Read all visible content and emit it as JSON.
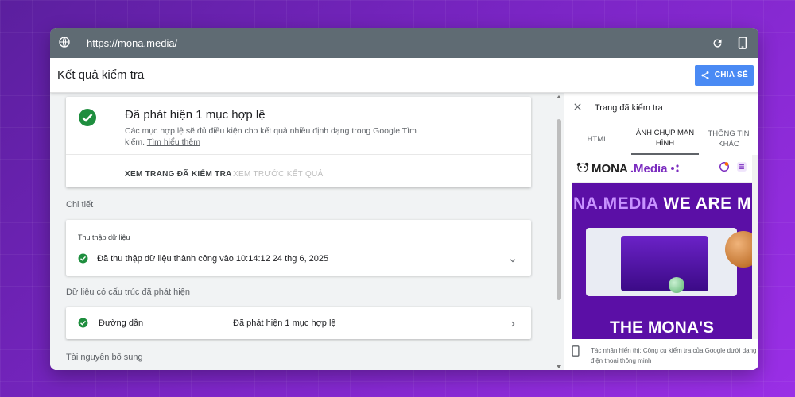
{
  "browser": {
    "url": "https://mona.media/"
  },
  "appbar": {
    "title": "Kết quả kiểm tra",
    "share_label": "CHIA SẺ"
  },
  "summary": {
    "heading": "Đã phát hiện 1 mục hợp lệ",
    "description": "Các mục hợp lệ sẽ đủ điều kiện cho kết quả nhiều định dạng trong Google Tìm kiếm.",
    "learn_more": "Tìm hiểu thêm",
    "view_tested_page": "XEM TRANG ĐÃ KIỂM TRA",
    "preview_results": "XEM TRƯỚC KẾT QUẢ"
  },
  "details": {
    "section_label": "Chi tiết",
    "crawl_label": "Thu thập dữ liệu",
    "crawl_status": "Đã thu thập dữ liệu thành công vào 10:14:12 24 thg 6, 2025"
  },
  "structured": {
    "section_label": "Dữ liệu có cấu trúc đã phát hiện",
    "item_name": "Đường dẫn",
    "item_value": "Đã phát hiện 1 mục hợp lệ"
  },
  "extra": {
    "section_label": "Tài nguyên bổ sung"
  },
  "panel": {
    "title": "Trang đã kiểm tra",
    "tabs": [
      {
        "label": "HTML"
      },
      {
        "label": "ẢNH CHỤP MÀN HÌNH"
      },
      {
        "label": "THÔNG TIN KHÁC"
      }
    ],
    "active_tab": "ẢNH CHỤP MÀN HÌNH",
    "screenshot": {
      "logo_text": "MONA",
      "logo_suffix": ".Media",
      "hero_text": "NA.MEDIA",
      "hero_text2": "WE ARE M",
      "hero_bottom": "THE MONA'S"
    },
    "agent_text": "Tác nhân hiển thị: Công cụ kiểm tra của Google dưới dạng điện thoại thông minh"
  },
  "colors": {
    "accent": "#4a8af4",
    "success": "#1e8e3e",
    "brand_purple": "#5b0fa6"
  }
}
